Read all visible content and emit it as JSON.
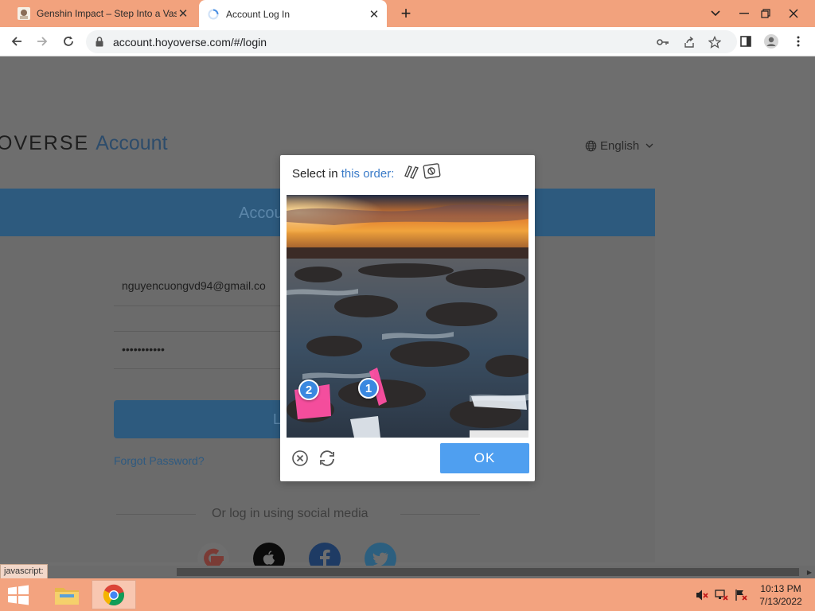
{
  "browser": {
    "tabs": [
      {
        "title": "Genshin Impact – Step Into a Vas",
        "active": false,
        "favicon": "genshin-favicon"
      },
      {
        "title": "Account Log In",
        "active": true,
        "favicon": "loading-spinner-icon"
      }
    ],
    "url": "account.hoyoverse.com/#/login"
  },
  "page": {
    "brand_prefix": "OVERSE",
    "brand_suffix": "Account",
    "language": "English",
    "panel_title": "Accou",
    "email_value": "nguyencuongvd94@gmail.co",
    "password_value": "•••••••••••",
    "login_button": "L",
    "forgot_password": "Forgot Password?",
    "social_prompt": "Or log in using social media",
    "social_icons": [
      "google-icon",
      "apple-icon",
      "facebook-icon",
      "twitter-icon"
    ],
    "status_text": "javascript:"
  },
  "captcha": {
    "prompt_prefix": "Select in ",
    "prompt_link": "this order:",
    "markers": [
      {
        "label": "1"
      },
      {
        "label": "2"
      }
    ],
    "ok_button": "OK"
  },
  "taskbar": {
    "time": "10:13 PM",
    "date": "7/13/2022"
  },
  "colors": {
    "tabbar": "#f2a27d",
    "taskbar": "#f3a37f",
    "accent_blue": "#4f9ff0",
    "marker_blue": "#3a88e0",
    "link_blue": "#3a7bc8"
  }
}
